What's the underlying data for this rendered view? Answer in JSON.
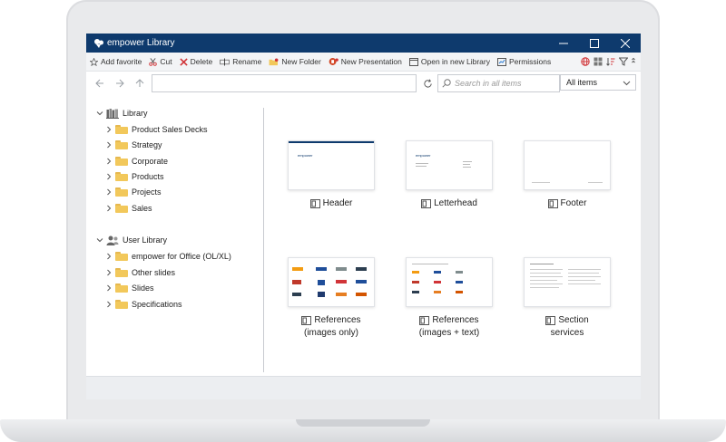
{
  "window": {
    "title": "empower Library"
  },
  "toolbar": {
    "add_favorite": "Add favorite",
    "cut": "Cut",
    "delete": "Delete",
    "rename": "Rename",
    "new_folder": "New Folder",
    "new_presentation": "New Presentation",
    "open_new_library": "Open in new Library",
    "permissions": "Permissions"
  },
  "nav": {
    "address_value": "",
    "search_placeholder": "Search in all items",
    "scope_value": "All items"
  },
  "tree": {
    "library": {
      "label": "Library",
      "children": [
        "Product Sales Decks",
        "Strategy",
        "Corporate",
        "Products",
        "Projects",
        "Sales"
      ]
    },
    "user_library": {
      "label": "User Library",
      "children": [
        "empower for Office (OL/XL)",
        "Other slides",
        "Slides",
        "Specifications"
      ]
    }
  },
  "items": [
    {
      "line1": "Header",
      "line2": ""
    },
    {
      "line1": "Letterhead",
      "line2": ""
    },
    {
      "line1": "Footer",
      "line2": ""
    },
    {
      "line1": "References",
      "line2": "(images only)"
    },
    {
      "line1": "References",
      "line2": "(images + text)"
    },
    {
      "line1": "Section",
      "line2": "services"
    }
  ],
  "thumb_text": {
    "brand": "empower"
  },
  "colors": {
    "titlebar": "#0e3a6d",
    "folder": "#f2c85b",
    "accent_red": "#d13438"
  }
}
